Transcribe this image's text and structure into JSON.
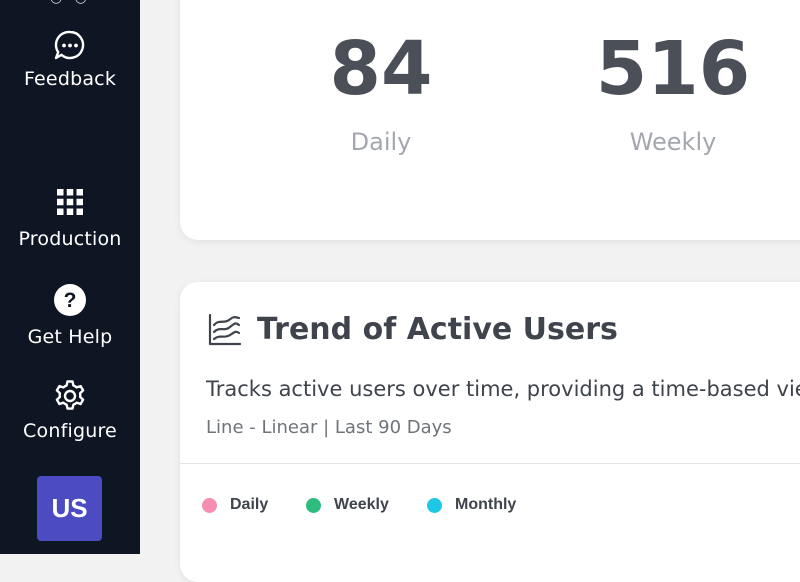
{
  "sidebar": {
    "items": [
      {
        "label": "Feedback",
        "icon": "chat-bubble-icon"
      },
      {
        "label": "Production",
        "icon": "grid-icon"
      },
      {
        "label": "Get Help",
        "icon": "help-icon"
      },
      {
        "label": "Configure",
        "icon": "gear-icon"
      }
    ],
    "avatar": "US"
  },
  "stats": {
    "daily": {
      "value": "84",
      "label": "Daily"
    },
    "weekly": {
      "value": "516",
      "label": "Weekly"
    }
  },
  "trend": {
    "title": "Trend of Active Users",
    "description": "Tracks active users over time, providing a time-based view",
    "meta": "Line - Linear | Last 90 Days",
    "legend": [
      {
        "label": "Daily",
        "color": "#f48fb1"
      },
      {
        "label": "Weekly",
        "color": "#2dbd7e"
      },
      {
        "label": "Monthly",
        "color": "#1ec8e4"
      }
    ]
  },
  "colors": {
    "sidebar_bg": "#0f1623",
    "avatar_bg": "#4c4bc2"
  }
}
